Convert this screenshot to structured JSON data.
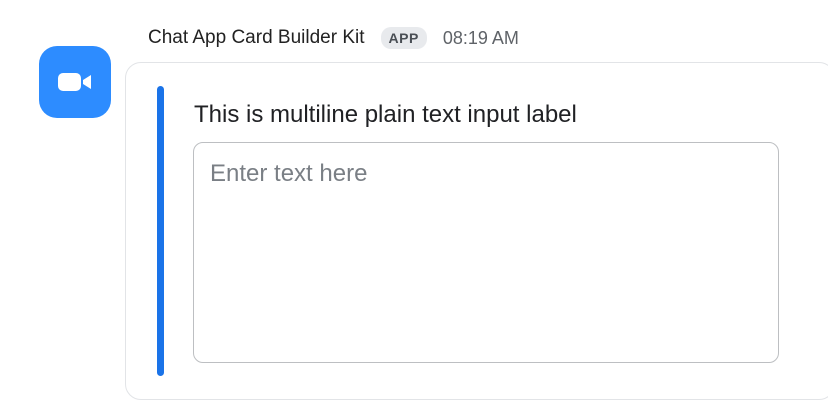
{
  "message": {
    "sender": "Chat App Card Builder Kit",
    "badge": "APP",
    "time": "08:19 AM",
    "avatar_icon": "video-camera-icon"
  },
  "card": {
    "input_label": "This is multiline plain text input label",
    "input_placeholder": "Enter text here",
    "input_value": ""
  },
  "colors": {
    "accent": "#1a73e8",
    "avatar_bg": "#2d8cff"
  }
}
